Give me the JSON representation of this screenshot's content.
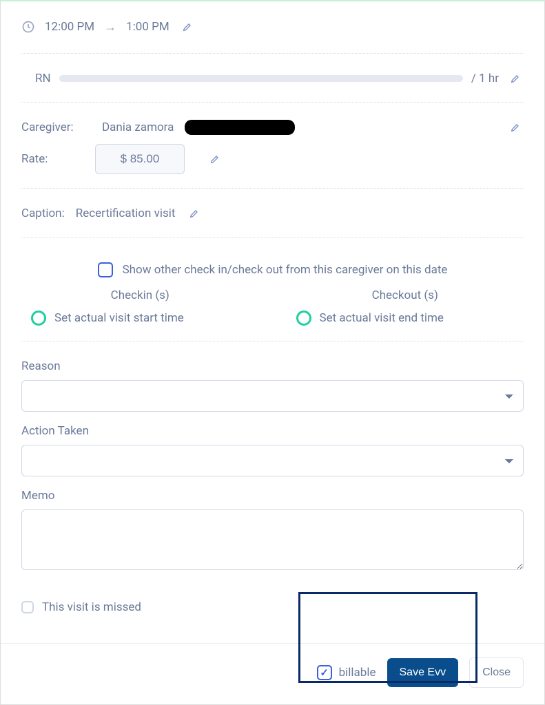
{
  "time_row": {
    "start": "12:00 PM",
    "end": "1:00 PM"
  },
  "rn": {
    "label": "RN",
    "duration": "/ 1 hr"
  },
  "caregiver": {
    "label": "Caregiver:",
    "name": "Dania zamora"
  },
  "rate": {
    "label": "Rate:",
    "value": "$ 85.00"
  },
  "caption": {
    "label": "Caption:",
    "value": "Recertification visit"
  },
  "show_other_label": "Show other check in/check out from this caregiver on this date",
  "checkin": {
    "header": "Checkin (s)",
    "action": "Set actual visit start time"
  },
  "checkout": {
    "header": "Checkout (s)",
    "action": "Set actual visit end time"
  },
  "reason_label": "Reason",
  "action_taken_label": "Action Taken",
  "memo_label": "Memo",
  "missed_label": "This visit is missed",
  "billable_label": "billable",
  "save_label": "Save Evv",
  "close_label": "Close"
}
